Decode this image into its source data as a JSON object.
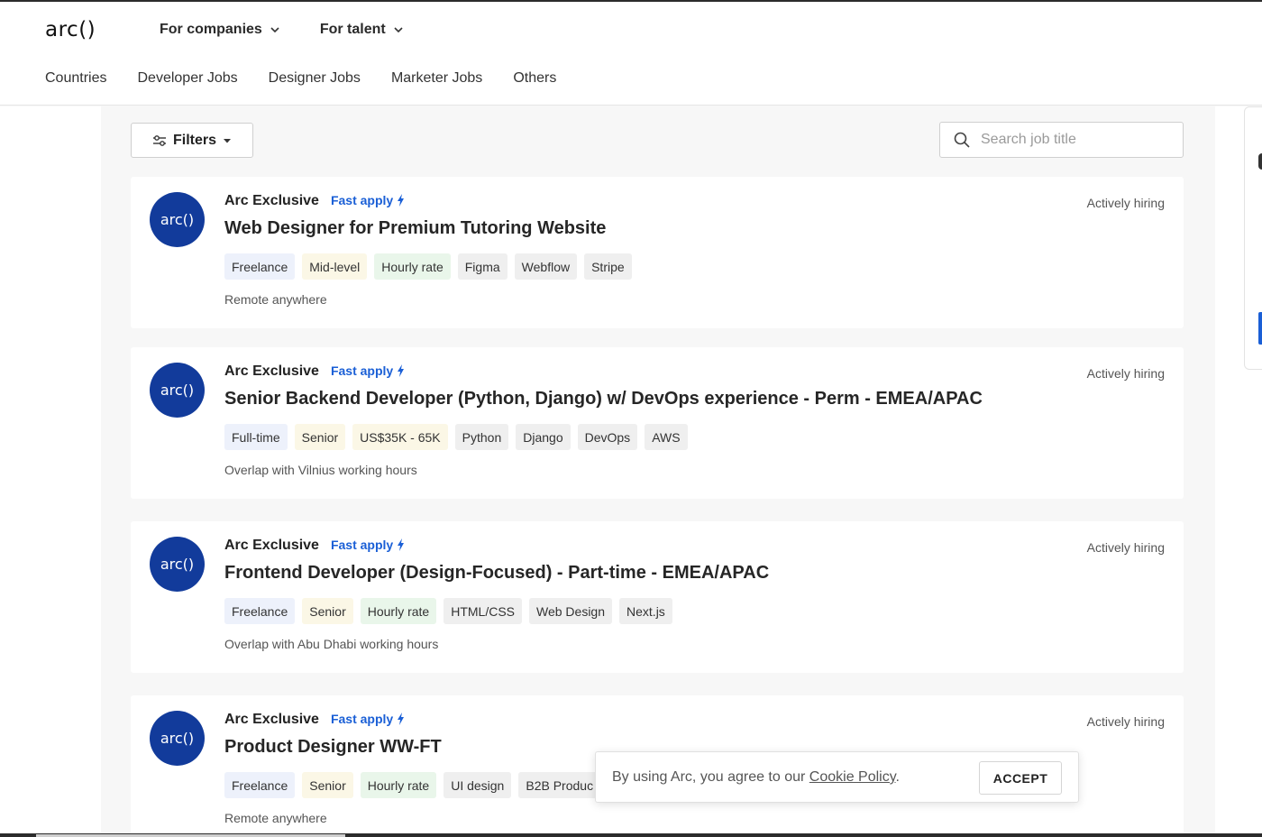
{
  "brand": {
    "logo": "arc()"
  },
  "topnav": [
    {
      "label": "For companies"
    },
    {
      "label": "For talent"
    }
  ],
  "subnav": [
    {
      "label": "Countries"
    },
    {
      "label": "Developer Jobs"
    },
    {
      "label": "Designer Jobs"
    },
    {
      "label": "Marketer Jobs"
    },
    {
      "label": "Others"
    }
  ],
  "toolbar": {
    "filters_label": "Filters",
    "search_placeholder": "Search job title",
    "search_value": ""
  },
  "jobs": [
    {
      "avatar": "arc()",
      "company": "Arc Exclusive",
      "fast_apply": "Fast apply",
      "title": "Web Designer for Premium Tutoring Website",
      "status": "Actively hiring",
      "tags": [
        {
          "label": "Freelance",
          "kind": "type"
        },
        {
          "label": "Mid-level",
          "kind": "level"
        },
        {
          "label": "Hourly rate",
          "kind": "pay"
        },
        {
          "label": "Figma",
          "kind": "skill"
        },
        {
          "label": "Webflow",
          "kind": "skill"
        },
        {
          "label": "Stripe",
          "kind": "skill"
        }
      ],
      "location": "Remote anywhere"
    },
    {
      "avatar": "arc()",
      "company": "Arc Exclusive",
      "fast_apply": "Fast apply",
      "title": "Senior Backend Developer (Python, Django) w/ DevOps experience - Perm - EMEA/APAC",
      "status": "Actively hiring",
      "tags": [
        {
          "label": "Full-time",
          "kind": "type"
        },
        {
          "label": "Senior",
          "kind": "level"
        },
        {
          "label": "US$35K - 65K",
          "kind": "level"
        },
        {
          "label": "Python",
          "kind": "skill"
        },
        {
          "label": "Django",
          "kind": "skill"
        },
        {
          "label": "DevOps",
          "kind": "skill"
        },
        {
          "label": "AWS",
          "kind": "skill"
        }
      ],
      "location": "Overlap with Vilnius working hours"
    },
    {
      "avatar": "arc()",
      "company": "Arc Exclusive",
      "fast_apply": "Fast apply",
      "title": "Frontend Developer (Design-Focused) - Part-time - EMEA/APAC",
      "status": "Actively hiring",
      "tags": [
        {
          "label": "Freelance",
          "kind": "type"
        },
        {
          "label": "Senior",
          "kind": "level"
        },
        {
          "label": "Hourly rate",
          "kind": "pay"
        },
        {
          "label": "HTML/CSS",
          "kind": "skill"
        },
        {
          "label": "Web Design",
          "kind": "skill"
        },
        {
          "label": "Next.js",
          "kind": "skill"
        }
      ],
      "location": "Overlap with Abu Dhabi working hours"
    },
    {
      "avatar": "arc()",
      "company": "Arc Exclusive",
      "fast_apply": "Fast apply",
      "title": "Product Designer WW-FT",
      "status": "Actively hiring",
      "tags": [
        {
          "label": "Freelance",
          "kind": "type"
        },
        {
          "label": "Senior",
          "kind": "level"
        },
        {
          "label": "Hourly rate",
          "kind": "pay"
        },
        {
          "label": "UI design",
          "kind": "skill"
        },
        {
          "label": "B2B Produc",
          "kind": "skill"
        }
      ],
      "location": "Remote anywhere"
    }
  ],
  "cookie": {
    "text": "By using Arc, you agree to our ",
    "link": "Cookie Policy",
    "suffix": ".",
    "accept_label": "ACCEPT"
  }
}
